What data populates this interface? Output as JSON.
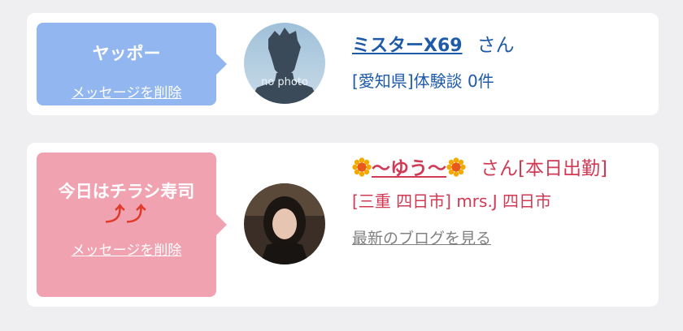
{
  "cards": [
    {
      "bubble_title": "ヤッポー",
      "delete_label": "メッセージを削除",
      "name": "ミスターX69",
      "honorific": "さん",
      "sub": "[愛知県]体験談 0件",
      "avatar_text": "no photo",
      "colors": {
        "bubble": "#92b6ef",
        "text": "#1e5aa8"
      }
    },
    {
      "bubble_title": "今日はチラシ寿司",
      "bubble_arrows": "⤴⤴",
      "delete_label": "メッセージを削除",
      "name_prefix_icon": "sunflower-icon",
      "name": "〜ゆう〜",
      "name_suffix_icon": "sunflower-icon",
      "honorific_status": "さん[本日出勤]",
      "sub": "[三重 四日市] mrs.J 四日市",
      "blog_link": "最新のブログを見る",
      "colors": {
        "bubble": "#f1a2b1",
        "text": "#d03a55",
        "arrows": "#e03a2a"
      }
    }
  ]
}
